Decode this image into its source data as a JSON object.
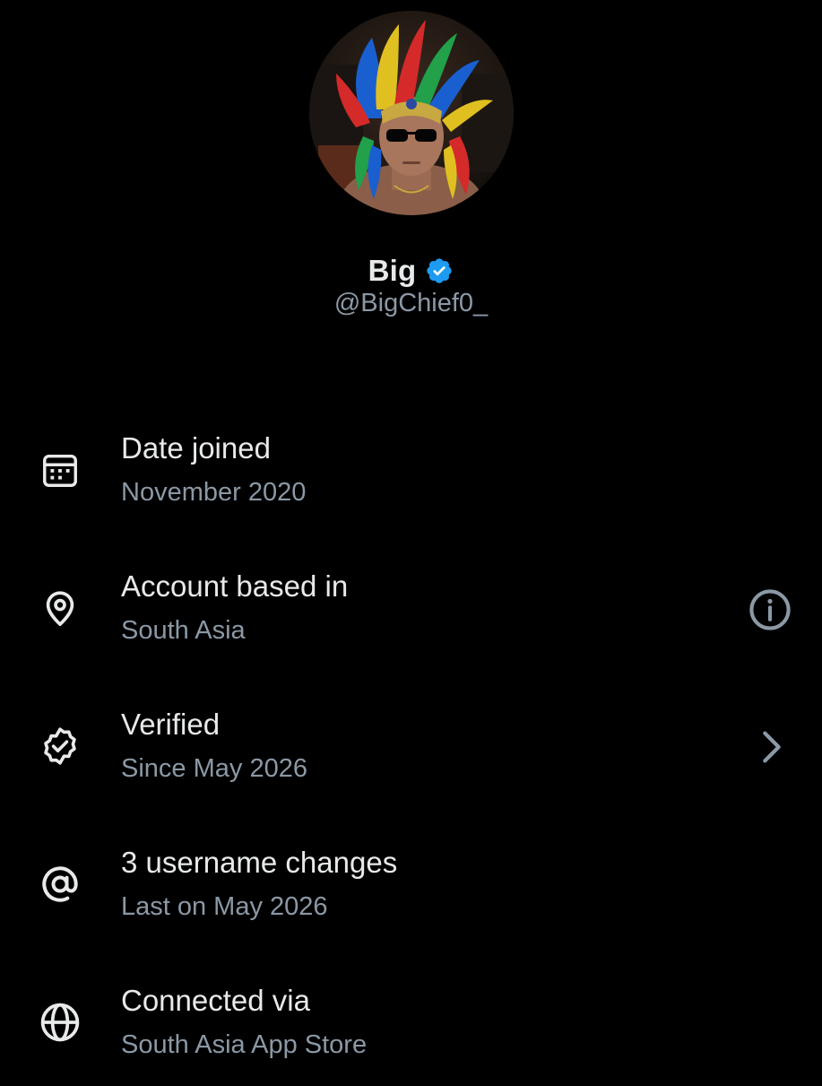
{
  "profile": {
    "display_name": "Big",
    "handle": "@BigChief0_",
    "verified": true,
    "avatar_icon": "profile-photo-feather-headdress"
  },
  "about": {
    "rows": [
      {
        "icon": "calendar-icon",
        "title": "Date joined",
        "subtitle": "November 2020"
      },
      {
        "icon": "location-pin-icon",
        "title": "Account based in",
        "subtitle": "South Asia",
        "action_icon": "info-icon"
      },
      {
        "icon": "verified-badge-icon",
        "title": "Verified",
        "subtitle": "Since May 2026",
        "action_icon": "chevron-right-icon"
      },
      {
        "icon": "at-sign-icon",
        "title": "3 username changes",
        "subtitle": "Last on May 2026"
      },
      {
        "icon": "globe-icon",
        "title": "Connected via",
        "subtitle": "South Asia App Store"
      }
    ]
  },
  "colors": {
    "background": "#000000",
    "primary_text": "#e7e9ea",
    "secondary_text": "#8b98a5",
    "verified_blue": "#1d9bf0"
  }
}
